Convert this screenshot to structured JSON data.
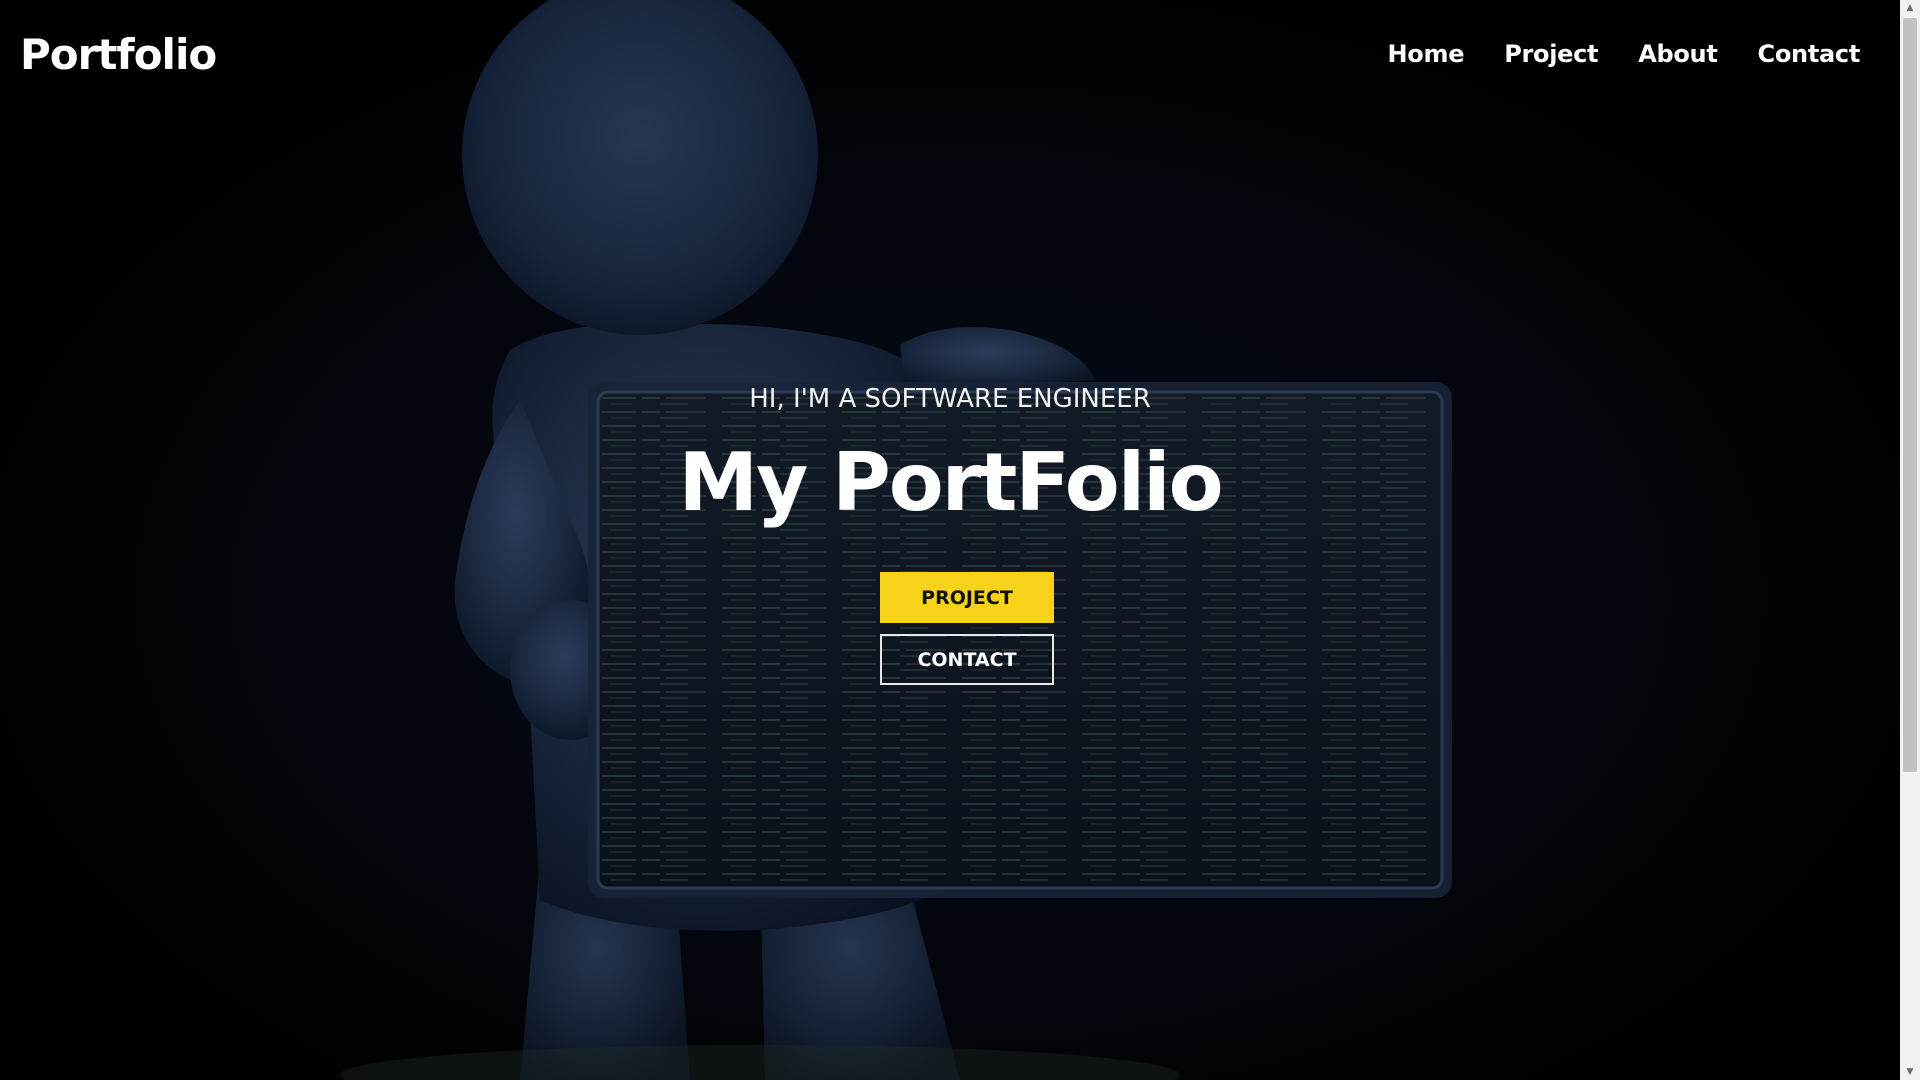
{
  "brand": {
    "logo": "Portfolio"
  },
  "nav": {
    "items": [
      {
        "label": "Home"
      },
      {
        "label": "Project"
      },
      {
        "label": "About"
      },
      {
        "label": "Contact"
      }
    ]
  },
  "hero": {
    "subtitle": "HI, I'M A SOFTWARE ENGINEER",
    "title": "My PortFolio",
    "buttons": {
      "project_label": "PROJECT",
      "contact_label": "CONTACT"
    }
  },
  "colors": {
    "accent": "#f6d31a",
    "background": "#000000",
    "text": "#ffffff"
  }
}
